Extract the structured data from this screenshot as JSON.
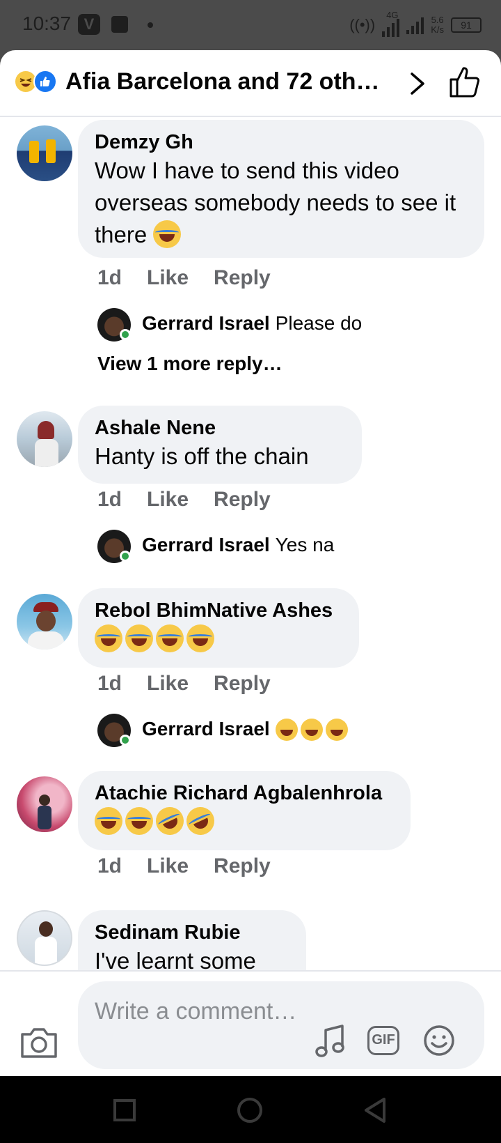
{
  "status_bar": {
    "time": "10:37",
    "v_icon": "V",
    "network": "4G",
    "speed_value": "5.6",
    "speed_unit": "K/s",
    "battery": "91"
  },
  "header": {
    "title": "Afia Barcelona and 72 oth…",
    "reaction_icons": [
      "haha-icon",
      "like-icon"
    ]
  },
  "comments": [
    {
      "author": "Demzy Gh",
      "text": "Wow I have to send this video overseas somebody needs to see it there",
      "emoji": "😂",
      "time": "1d",
      "like": "Like",
      "reply": "Reply",
      "reply_preview": {
        "author": "Gerrard Israel",
        "text": "Please do"
      },
      "more_replies": "View 1 more reply…"
    },
    {
      "author": "Ashale Nene",
      "text": "Hanty is off the chain",
      "time": "1d",
      "like": "Like",
      "reply": "Reply",
      "reply_preview": {
        "author": "Gerrard Israel",
        "text": "Yes na"
      }
    },
    {
      "author": "Rebol BhimNative Ashes",
      "text": "😂😂😂😂",
      "time": "1d",
      "like": "Like",
      "reply": "Reply",
      "reply_preview": {
        "author": "Gerrard Israel",
        "text": "😆😆😆"
      }
    },
    {
      "author": "Atachie Richard Agbalenhrola",
      "text": "😂😂🤣🤣",
      "time": "1d",
      "like": "Like",
      "reply": "Reply"
    },
    {
      "author": "Sedinam Rubie",
      "text": "I've learnt some"
    }
  ],
  "composer": {
    "placeholder": "Write a comment…",
    "icons": [
      "camera-icon",
      "music-icon",
      "gif-icon",
      "emoji-icon"
    ],
    "gif_label": "GIF"
  }
}
